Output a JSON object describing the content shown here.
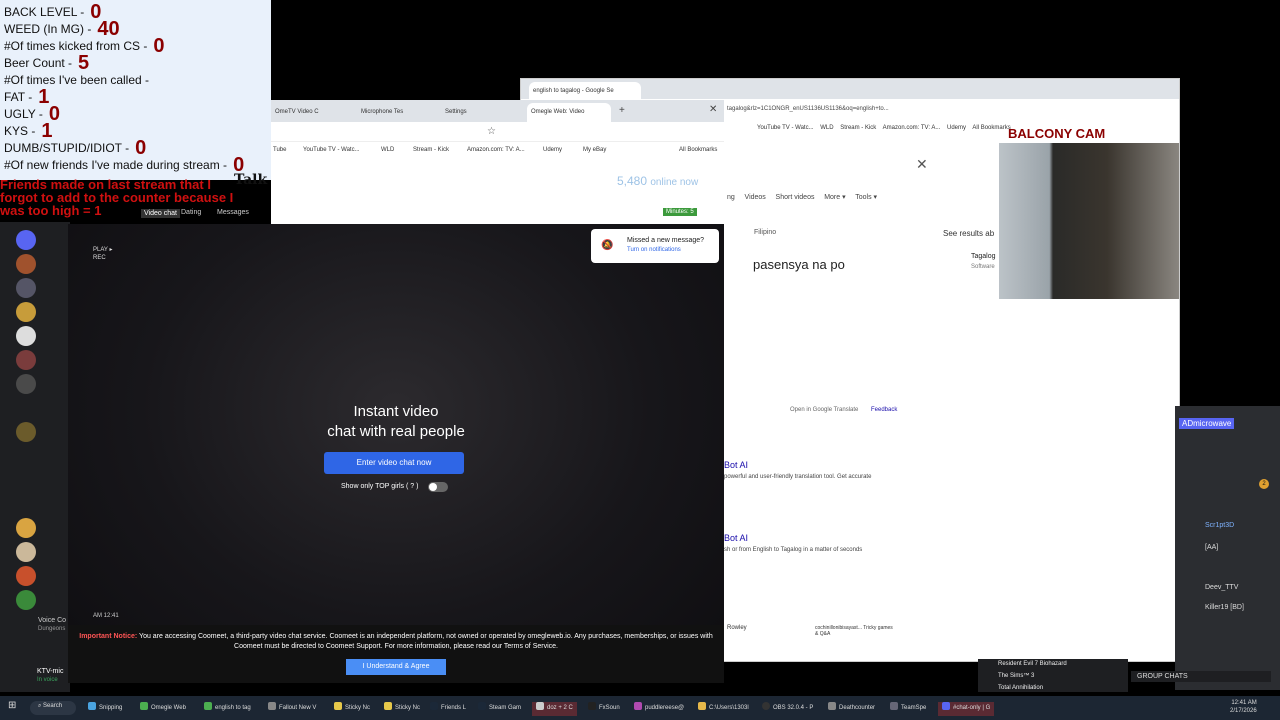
{
  "overlay": {
    "counters": [
      {
        "label": "BACK LEVEL -",
        "value": "0"
      },
      {
        "label": "WEED (In MG) -",
        "value": "40"
      },
      {
        "label": "#Of times kicked from CS -",
        "value": "0"
      },
      {
        "label": "Beer Count -",
        "value": "5"
      },
      {
        "label": "#Of times I've been called -",
        "value": ""
      },
      {
        "label": "FAT -",
        "value": "1"
      },
      {
        "label": "UGLY -",
        "value": "0"
      },
      {
        "label": "KYS -",
        "value": "1"
      },
      {
        "label": "DUMB/STUPID/IDIOT -",
        "value": "0"
      },
      {
        "label": "#Of new friends I've made during stream -",
        "value": "0"
      }
    ],
    "friends_note": "Friends made on last stream that I forgot to add to the counter because I was too high = 1",
    "talk_title": "Talk to strangers!",
    "balcony_label": "BALCONY CAM"
  },
  "discord_left": {
    "channel_voice": "Voice Co",
    "channel_sub": "Dungeons",
    "user_name": "KTV-mic",
    "user_status": "In voice"
  },
  "chrome1": {
    "tabs": [
      "OmeTV Video C",
      "Microphone Tes",
      "Settings",
      "Omegle Web: Video"
    ],
    "bookmarks": [
      "Tube",
      "YouTube TV - Watc...",
      "WLD",
      "Stream - Kick",
      "Amazon.com: TV: A...",
      "Udemy",
      "My eBay",
      "All Bookmarks"
    ],
    "online_count": "5,480",
    "online_label": "online now",
    "nav": [
      "Video chat",
      "Dating",
      "Messages"
    ],
    "minutes_label": "Minutes: 5",
    "rec_label": "PLAY ▸ REC",
    "hero_line1": "Instant video",
    "hero_line2": "chat with real people",
    "enter_button": "Enter video chat now",
    "top_girls": "Show only TOP girls ( ? )",
    "notif_title": "Missed a new message?",
    "notif_action": "Turn on notifications",
    "timestamp": "AM 12:41",
    "notice_bold": "Important Notice:",
    "notice_text": "You are accessing Coomeet, a third-party video chat service. Coomeet is an independent platform, not owned or operated by omegleweb.io. Any purchases, memberships, or issues with Coomeet must be directed to Coomeet Support. For more information, please read our Terms of Service.",
    "agree_button": "I Understand & Agree"
  },
  "chrome2": {
    "tab_title": "english to tagalog - Google Se",
    "address": "tagalog&rlz=1C1ONGR_enUS1136US1136&oq=english+to...",
    "bookmarks": [
      "YouTube TV - Watc...",
      "WLD",
      "Stream - Kick",
      "Amazon.com: TV: A...",
      "Udemy",
      "All Bookmarks"
    ],
    "search_tabs": [
      "ng",
      "Videos",
      "Short videos",
      "More ▾",
      "Tools ▾"
    ],
    "lang": "Filipino",
    "translated": "pasensya na po",
    "see_results": "See results ab",
    "result_name": "Tagalog",
    "result_sub": "Software",
    "open_translate": "Open in Google Translate",
    "feedback": "Feedback",
    "bot_ai_1": "Bot AI",
    "bot_text_1": "powerful and user-friendly translation tool. Get accurate",
    "bot_ai_2": "Bot AI",
    "bot_text_2": "sh or from English to Tagalog in a matter of seconds",
    "card_1": "Rowley",
    "card_2": "cochinillonibisayast... Tricky games & Q&A"
  },
  "discord_right": {
    "title": "ADmicrowave",
    "users": [
      "Scr1pt3D",
      "[AA]",
      "Deev_TTV",
      "Killer19 [BD]"
    ],
    "badge": "2",
    "group_chats": "GROUP CHATS"
  },
  "games": [
    "Resident Evil 7 Biohazard",
    "The Sims™ 3",
    "Total Annihilation"
  ],
  "taskbar": {
    "search": "Search",
    "items": [
      "Snipping",
      "Omegle Web",
      "english to tag",
      "Fallout New V",
      "Sticky Nc",
      "Sticky Nc",
      "Friends L",
      "Steam Gam",
      "doz + 2 C",
      "FxSoun",
      "puddlereese@",
      "C:\\Users\\1303l",
      "OBS 32.0.4 - P",
      "Deathcounter",
      "TeamSpe",
      "#chat-only | G"
    ],
    "time": "12:41 AM",
    "date": "2/17/2026"
  },
  "colors": {
    "accent_blue": "#2f66e6",
    "counter_red": "#8b0000",
    "discord_dark": "#1e1f22"
  }
}
